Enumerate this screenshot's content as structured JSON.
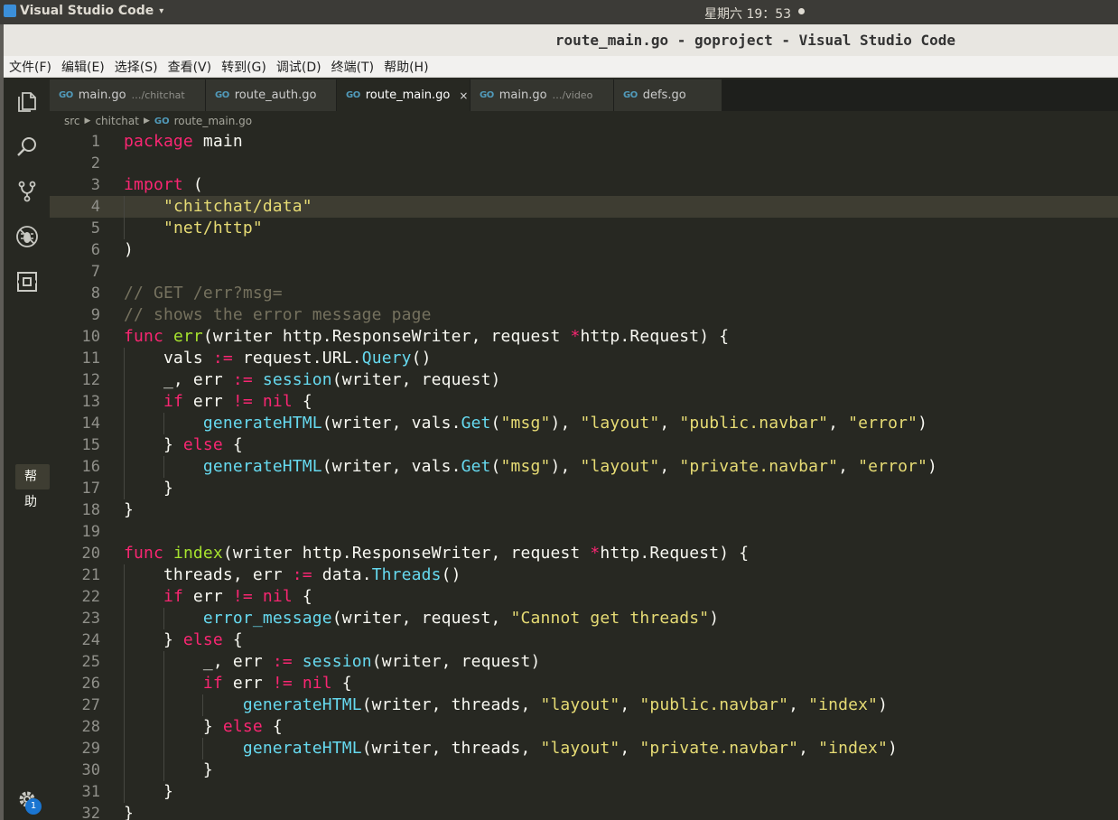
{
  "system_bar": {
    "app_name": "Visual Studio Code",
    "caret": "▾",
    "clock": "星期六 19：53"
  },
  "window": {
    "title": "route_main.go - goproject - Visual Studio Code"
  },
  "menu": [
    "文件(F)",
    "编辑(E)",
    "选择(S)",
    "查看(V)",
    "转到(G)",
    "调试(D)",
    "终端(T)",
    "帮助(H)"
  ],
  "activity_bar": {
    "tooltip": "帮助",
    "icons": [
      "files-icon",
      "search-icon",
      "source-control-icon",
      "debug-icon",
      "extensions-icon"
    ],
    "settings_badge": "1"
  },
  "tabs": [
    {
      "label": "main.go",
      "desc": "…/chitchat",
      "active": false
    },
    {
      "label": "route_auth.go",
      "desc": "",
      "active": false
    },
    {
      "label": "route_main.go",
      "desc": "",
      "active": true
    },
    {
      "label": "main.go",
      "desc": "…/video",
      "active": false
    },
    {
      "label": "defs.go",
      "desc": "",
      "active": false
    }
  ],
  "tab_icon_text": "GO",
  "tab_close": "×",
  "breadcrumb": [
    "src",
    "chitchat",
    "route_main.go"
  ],
  "editor": {
    "highlighted_line": 4,
    "lines": [
      [
        [
          "k",
          "package"
        ],
        [
          "p",
          " main"
        ]
      ],
      [],
      [
        [
          "k",
          "import"
        ],
        [
          "p",
          " ("
        ]
      ],
      [
        [
          "p",
          "    "
        ],
        [
          "s",
          "\"chitchat/data\""
        ]
      ],
      [
        [
          "p",
          "    "
        ],
        [
          "s",
          "\"net/http\""
        ]
      ],
      [
        [
          "p",
          ")"
        ]
      ],
      [],
      [
        [
          "c",
          "// GET /err?msg="
        ]
      ],
      [
        [
          "c",
          "// shows the error message page"
        ]
      ],
      [
        [
          "k",
          "func"
        ],
        [
          "p",
          " "
        ],
        [
          "def",
          "err"
        ],
        [
          "p",
          "(writer http.ResponseWriter, request "
        ],
        [
          "n",
          "*"
        ],
        [
          "p",
          "http.Request) {"
        ]
      ],
      [
        [
          "p",
          "    vals "
        ],
        [
          "n",
          ":="
        ],
        [
          "p",
          " request.URL."
        ],
        [
          "f",
          "Query"
        ],
        [
          "p",
          "()"
        ]
      ],
      [
        [
          "p",
          "    _, err "
        ],
        [
          "n",
          ":="
        ],
        [
          "p",
          " "
        ],
        [
          "f",
          "session"
        ],
        [
          "p",
          "(writer, request)"
        ]
      ],
      [
        [
          "p",
          "    "
        ],
        [
          "k",
          "if"
        ],
        [
          "p",
          " err "
        ],
        [
          "n",
          "!="
        ],
        [
          "p",
          " "
        ],
        [
          "k",
          "nil"
        ],
        [
          "p",
          " {"
        ]
      ],
      [
        [
          "p",
          "        "
        ],
        [
          "f",
          "generateHTML"
        ],
        [
          "p",
          "(writer, vals."
        ],
        [
          "f",
          "Get"
        ],
        [
          "p",
          "("
        ],
        [
          "s",
          "\"msg\""
        ],
        [
          "p",
          "), "
        ],
        [
          "s",
          "\"layout\""
        ],
        [
          "p",
          ", "
        ],
        [
          "s",
          "\"public.navbar\""
        ],
        [
          "p",
          ", "
        ],
        [
          "s",
          "\"error\""
        ],
        [
          "p",
          ")"
        ]
      ],
      [
        [
          "p",
          "    } "
        ],
        [
          "k",
          "else"
        ],
        [
          "p",
          " {"
        ]
      ],
      [
        [
          "p",
          "        "
        ],
        [
          "f",
          "generateHTML"
        ],
        [
          "p",
          "(writer, vals."
        ],
        [
          "f",
          "Get"
        ],
        [
          "p",
          "("
        ],
        [
          "s",
          "\"msg\""
        ],
        [
          "p",
          "), "
        ],
        [
          "s",
          "\"layout\""
        ],
        [
          "p",
          ", "
        ],
        [
          "s",
          "\"private.navbar\""
        ],
        [
          "p",
          ", "
        ],
        [
          "s",
          "\"error\""
        ],
        [
          "p",
          ")"
        ]
      ],
      [
        [
          "p",
          "    }"
        ]
      ],
      [
        [
          "p",
          "}"
        ]
      ],
      [],
      [
        [
          "k",
          "func"
        ],
        [
          "p",
          " "
        ],
        [
          "def",
          "index"
        ],
        [
          "p",
          "(writer http.ResponseWriter, request "
        ],
        [
          "n",
          "*"
        ],
        [
          "p",
          "http.Request) {"
        ]
      ],
      [
        [
          "p",
          "    threads, err "
        ],
        [
          "n",
          ":="
        ],
        [
          "p",
          " data."
        ],
        [
          "f",
          "Threads"
        ],
        [
          "p",
          "()"
        ]
      ],
      [
        [
          "p",
          "    "
        ],
        [
          "k",
          "if"
        ],
        [
          "p",
          " err "
        ],
        [
          "n",
          "!="
        ],
        [
          "p",
          " "
        ],
        [
          "k",
          "nil"
        ],
        [
          "p",
          " {"
        ]
      ],
      [
        [
          "p",
          "        "
        ],
        [
          "f",
          "error_message"
        ],
        [
          "p",
          "(writer, request, "
        ],
        [
          "s",
          "\"Cannot get threads\""
        ],
        [
          "p",
          ")"
        ]
      ],
      [
        [
          "p",
          "    } "
        ],
        [
          "k",
          "else"
        ],
        [
          "p",
          " {"
        ]
      ],
      [
        [
          "p",
          "        _, err "
        ],
        [
          "n",
          ":="
        ],
        [
          "p",
          " "
        ],
        [
          "f",
          "session"
        ],
        [
          "p",
          "(writer, request)"
        ]
      ],
      [
        [
          "p",
          "        "
        ],
        [
          "k",
          "if"
        ],
        [
          "p",
          " err "
        ],
        [
          "n",
          "!="
        ],
        [
          "p",
          " "
        ],
        [
          "k",
          "nil"
        ],
        [
          "p",
          " {"
        ]
      ],
      [
        [
          "p",
          "            "
        ],
        [
          "f",
          "generateHTML"
        ],
        [
          "p",
          "(writer, threads, "
        ],
        [
          "s",
          "\"layout\""
        ],
        [
          "p",
          ", "
        ],
        [
          "s",
          "\"public.navbar\""
        ],
        [
          "p",
          ", "
        ],
        [
          "s",
          "\"index\""
        ],
        [
          "p",
          ")"
        ]
      ],
      [
        [
          "p",
          "        } "
        ],
        [
          "k",
          "else"
        ],
        [
          "p",
          " {"
        ]
      ],
      [
        [
          "p",
          "            "
        ],
        [
          "f",
          "generateHTML"
        ],
        [
          "p",
          "(writer, threads, "
        ],
        [
          "s",
          "\"layout\""
        ],
        [
          "p",
          ", "
        ],
        [
          "s",
          "\"private.navbar\""
        ],
        [
          "p",
          ", "
        ],
        [
          "s",
          "\"index\""
        ],
        [
          "p",
          ")"
        ]
      ],
      [
        [
          "p",
          "        }"
        ]
      ],
      [
        [
          "p",
          "    }"
        ]
      ],
      [
        [
          "p",
          "}"
        ]
      ]
    ]
  },
  "colors": {
    "editor_bg": "#272822",
    "keyword": "#f92672",
    "string": "#e6db74",
    "function": "#66d9ef",
    "comment": "#75715e",
    "definition": "#a6e22e"
  }
}
